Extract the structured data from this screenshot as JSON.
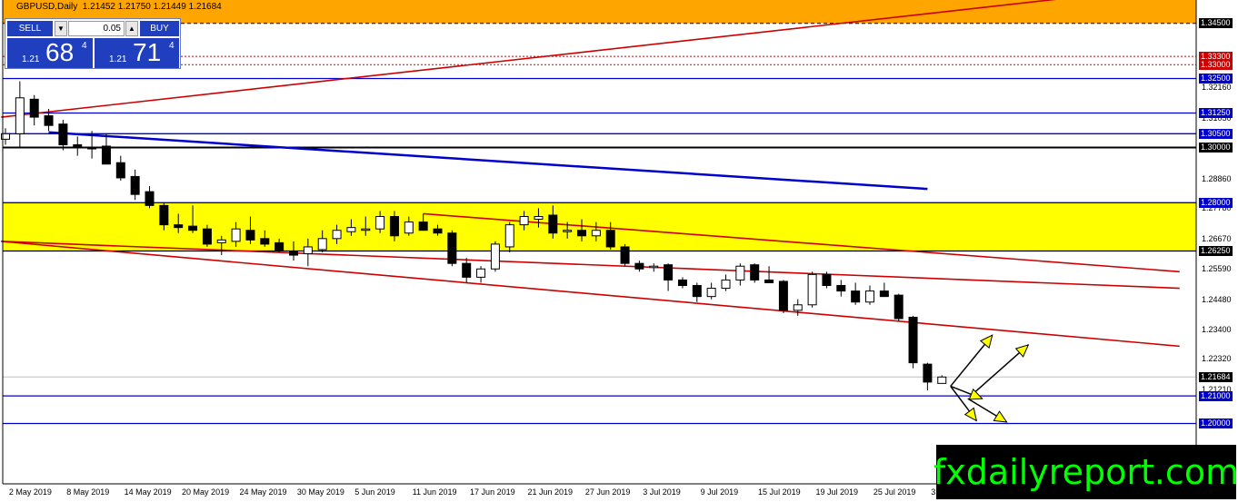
{
  "header": {
    "text": "GBPUSD,Daily  1.21452 1.21750 1.21449 1.21684"
  },
  "trade_panel": {
    "sell_label": "SELL",
    "buy_label": "BUY",
    "lot": "0.05",
    "sell_small": "1.21",
    "sell_big": "68",
    "sell_sup": "4",
    "buy_small": "1.21",
    "buy_big": "71",
    "buy_sup": "4"
  },
  "watermark": "fxdailyreport.com",
  "colors": {
    "zone": "#ffff00",
    "top_band": "#ffa500",
    "blue_line": "#0000cc",
    "red_line": "#cc0000",
    "arrow": "#ffff00"
  },
  "chart_data": {
    "type": "candlestick",
    "symbol": "GBPUSD",
    "timeframe": "Daily",
    "ylim": [
      1.195,
      1.355
    ],
    "price_labels": [
      "1.32160",
      "1.31050",
      "1.28860",
      "1.27780",
      "1.26670",
      "1.25590",
      "1.24480",
      "1.23400",
      "1.22320",
      "1.21210"
    ],
    "price_tags": [
      {
        "label": "1.34500",
        "value": 1.345,
        "style": "black"
      },
      {
        "label": "1.33300",
        "value": 1.333,
        "style": "red"
      },
      {
        "label": "1.33000",
        "value": 1.33,
        "style": "red"
      },
      {
        "label": "1.32500",
        "value": 1.325,
        "style": "blue"
      },
      {
        "label": "1.31250",
        "value": 1.3125,
        "style": "blue"
      },
      {
        "label": "1.30500",
        "value": 1.305,
        "style": "blue"
      },
      {
        "label": "1.30000",
        "value": 1.3,
        "style": "black"
      },
      {
        "label": "1.28000",
        "value": 1.28,
        "style": "blue"
      },
      {
        "label": "1.26250",
        "value": 1.2625,
        "style": "black"
      },
      {
        "label": "1.21684",
        "value": 1.21684,
        "style": "black"
      },
      {
        "label": "1.21000",
        "value": 1.21,
        "style": "blue"
      },
      {
        "label": "1.20000",
        "value": 1.2,
        "style": "blue"
      }
    ],
    "date_labels": [
      {
        "text": "2 May 2019",
        "index": 1
      },
      {
        "text": "8 May 2019",
        "index": 5
      },
      {
        "text": "14 May 2019",
        "index": 9
      },
      {
        "text": "20 May 2019",
        "index": 13
      },
      {
        "text": "24 May 2019",
        "index": 17
      },
      {
        "text": "30 May 2019",
        "index": 21
      },
      {
        "text": "5 Jun 2019",
        "index": 25
      },
      {
        "text": "11 Jun 2019",
        "index": 29
      },
      {
        "text": "17 Jun 2019",
        "index": 33
      },
      {
        "text": "21 Jun 2019",
        "index": 37
      },
      {
        "text": "27 Jun 2019",
        "index": 41
      },
      {
        "text": "3 Jul 2019",
        "index": 45
      },
      {
        "text": "9 Jul 2019",
        "index": 49
      },
      {
        "text": "15 Jul 2019",
        "index": 53
      },
      {
        "text": "19 Jul 2019",
        "index": 57
      },
      {
        "text": "25 Jul 2019",
        "index": 61
      },
      {
        "text": "3",
        "index": 65
      }
    ],
    "candles": [
      {
        "o": 1.303,
        "h": 1.307,
        "l": 1.301,
        "c": 1.305
      },
      {
        "o": 1.305,
        "h": 1.324,
        "l": 1.3,
        "c": 1.318
      },
      {
        "o": 1.3175,
        "h": 1.319,
        "l": 1.308,
        "c": 1.311
      },
      {
        "o": 1.3115,
        "h": 1.314,
        "l": 1.306,
        "c": 1.308
      },
      {
        "o": 1.3085,
        "h": 1.31,
        "l": 1.299,
        "c": 1.301
      },
      {
        "o": 1.301,
        "h": 1.304,
        "l": 1.297,
        "c": 1.3005
      },
      {
        "o": 1.3,
        "h": 1.306,
        "l": 1.296,
        "c": 1.2995
      },
      {
        "o": 1.3005,
        "h": 1.305,
        "l": 1.294,
        "c": 1.294
      },
      {
        "o": 1.2945,
        "h": 1.297,
        "l": 1.288,
        "c": 1.289
      },
      {
        "o": 1.2895,
        "h": 1.292,
        "l": 1.281,
        "c": 1.283
      },
      {
        "o": 1.284,
        "h": 1.286,
        "l": 1.278,
        "c": 1.279
      },
      {
        "o": 1.279,
        "h": 1.28,
        "l": 1.27,
        "c": 1.272
      },
      {
        "o": 1.272,
        "h": 1.276,
        "l": 1.269,
        "c": 1.271
      },
      {
        "o": 1.2715,
        "h": 1.279,
        "l": 1.269,
        "c": 1.27
      },
      {
        "o": 1.2705,
        "h": 1.272,
        "l": 1.264,
        "c": 1.265
      },
      {
        "o": 1.2655,
        "h": 1.268,
        "l": 1.261,
        "c": 1.2665
      },
      {
        "o": 1.266,
        "h": 1.273,
        "l": 1.264,
        "c": 1.2705
      },
      {
        "o": 1.27,
        "h": 1.275,
        "l": 1.265,
        "c": 1.2665
      },
      {
        "o": 1.267,
        "h": 1.27,
        "l": 1.264,
        "c": 1.265
      },
      {
        "o": 1.2655,
        "h": 1.267,
        "l": 1.262,
        "c": 1.2625
      },
      {
        "o": 1.2625,
        "h": 1.266,
        "l": 1.259,
        "c": 1.261
      },
      {
        "o": 1.2615,
        "h": 1.267,
        "l": 1.257,
        "c": 1.264
      },
      {
        "o": 1.263,
        "h": 1.27,
        "l": 1.262,
        "c": 1.267
      },
      {
        "o": 1.267,
        "h": 1.272,
        "l": 1.265,
        "c": 1.27
      },
      {
        "o": 1.2695,
        "h": 1.274,
        "l": 1.268,
        "c": 1.271
      },
      {
        "o": 1.27,
        "h": 1.275,
        "l": 1.268,
        "c": 1.2705
      },
      {
        "o": 1.2705,
        "h": 1.277,
        "l": 1.269,
        "c": 1.275
      },
      {
        "o": 1.275,
        "h": 1.277,
        "l": 1.266,
        "c": 1.268
      },
      {
        "o": 1.269,
        "h": 1.275,
        "l": 1.268,
        "c": 1.273
      },
      {
        "o": 1.273,
        "h": 1.276,
        "l": 1.27,
        "c": 1.27
      },
      {
        "o": 1.2705,
        "h": 1.272,
        "l": 1.268,
        "c": 1.269
      },
      {
        "o": 1.269,
        "h": 1.27,
        "l": 1.257,
        "c": 1.258
      },
      {
        "o": 1.258,
        "h": 1.26,
        "l": 1.251,
        "c": 1.253
      },
      {
        "o": 1.253,
        "h": 1.257,
        "l": 1.251,
        "c": 1.256
      },
      {
        "o": 1.256,
        "h": 1.266,
        "l": 1.255,
        "c": 1.265
      },
      {
        "o": 1.264,
        "h": 1.273,
        "l": 1.262,
        "c": 1.272
      },
      {
        "o": 1.272,
        "h": 1.277,
        "l": 1.27,
        "c": 1.275
      },
      {
        "o": 1.274,
        "h": 1.278,
        "l": 1.271,
        "c": 1.275
      },
      {
        "o": 1.2755,
        "h": 1.279,
        "l": 1.267,
        "c": 1.269
      },
      {
        "o": 1.2695,
        "h": 1.273,
        "l": 1.267,
        "c": 1.27
      },
      {
        "o": 1.27,
        "h": 1.274,
        "l": 1.266,
        "c": 1.268
      },
      {
        "o": 1.268,
        "h": 1.273,
        "l": 1.266,
        "c": 1.27
      },
      {
        "o": 1.27,
        "h": 1.273,
        "l": 1.263,
        "c": 1.264
      },
      {
        "o": 1.264,
        "h": 1.265,
        "l": 1.257,
        "c": 1.258
      },
      {
        "o": 1.258,
        "h": 1.259,
        "l": 1.255,
        "c": 1.256
      },
      {
        "o": 1.2565,
        "h": 1.258,
        "l": 1.255,
        "c": 1.257
      },
      {
        "o": 1.2575,
        "h": 1.258,
        "l": 1.248,
        "c": 1.252
      },
      {
        "o": 1.252,
        "h": 1.253,
        "l": 1.249,
        "c": 1.25
      },
      {
        "o": 1.25,
        "h": 1.251,
        "l": 1.244,
        "c": 1.246
      },
      {
        "o": 1.246,
        "h": 1.251,
        "l": 1.245,
        "c": 1.249
      },
      {
        "o": 1.249,
        "h": 1.254,
        "l": 1.248,
        "c": 1.252
      },
      {
        "o": 1.252,
        "h": 1.258,
        "l": 1.25,
        "c": 1.257
      },
      {
        "o": 1.2575,
        "h": 1.258,
        "l": 1.251,
        "c": 1.252
      },
      {
        "o": 1.252,
        "h": 1.257,
        "l": 1.251,
        "c": 1.251
      },
      {
        "o": 1.2515,
        "h": 1.252,
        "l": 1.24,
        "c": 1.241
      },
      {
        "o": 1.241,
        "h": 1.245,
        "l": 1.239,
        "c": 1.243
      },
      {
        "o": 1.243,
        "h": 1.255,
        "l": 1.242,
        "c": 1.254
      },
      {
        "o": 1.254,
        "h": 1.255,
        "l": 1.249,
        "c": 1.25
      },
      {
        "o": 1.25,
        "h": 1.252,
        "l": 1.246,
        "c": 1.248
      },
      {
        "o": 1.248,
        "h": 1.251,
        "l": 1.243,
        "c": 1.244
      },
      {
        "o": 1.244,
        "h": 1.25,
        "l": 1.243,
        "c": 1.248
      },
      {
        "o": 1.248,
        "h": 1.251,
        "l": 1.246,
        "c": 1.246
      },
      {
        "o": 1.2465,
        "h": 1.247,
        "l": 1.237,
        "c": 1.238
      },
      {
        "o": 1.2385,
        "h": 1.239,
        "l": 1.22,
        "c": 1.222
      },
      {
        "o": 1.2215,
        "h": 1.222,
        "l": 1.212,
        "c": 1.215
      },
      {
        "o": 1.21452,
        "h": 1.2175,
        "l": 1.21449,
        "c": 1.21684
      }
    ],
    "horizontal_lines": [
      {
        "value": 1.345,
        "style": "black-dashed"
      },
      {
        "value": 1.333,
        "style": "red-dotted"
      },
      {
        "value": 1.33,
        "style": "red-dotted"
      },
      {
        "value": 1.325,
        "style": "blue"
      },
      {
        "value": 1.3125,
        "style": "blue"
      },
      {
        "value": 1.305,
        "style": "blue"
      },
      {
        "value": 1.3,
        "style": "black-thick"
      },
      {
        "value": 1.28,
        "style": "blue"
      },
      {
        "value": 1.2625,
        "style": "black"
      },
      {
        "value": 1.21684,
        "style": "gray-thin"
      },
      {
        "value": 1.21,
        "style": "blue"
      },
      {
        "value": 1.2,
        "style": "blue"
      }
    ],
    "zone": {
      "from": 1.2625,
      "to": 1.28
    },
    "top_band": {
      "from": 1.345,
      "to": 1.355
    },
    "trendlines": [
      {
        "from": {
          "i": -0.3,
          "v": 1.311
        },
        "to": {
          "i": 76,
          "v": 1.3555
        },
        "color": "red"
      },
      {
        "from": {
          "i": -0.3,
          "v": 1.266
        },
        "to": {
          "i": 81.5,
          "v": 1.249
        },
        "color": "red"
      },
      {
        "from": {
          "i": 29,
          "v": 1.276
        },
        "to": {
          "i": 81.5,
          "v": 1.255
        },
        "color": "red"
      },
      {
        "from": {
          "i": -0.3,
          "v": 1.266
        },
        "to": {
          "i": 81.5,
          "v": 1.228
        },
        "color": "red"
      },
      {
        "from": {
          "i": 3,
          "v": 1.3055
        },
        "to": {
          "i": 64,
          "v": 1.285
        },
        "color": "blue"
      }
    ],
    "scenario_arrows": [
      {
        "from": {
          "i": 65.6,
          "v": 1.2135
        },
        "to": {
          "i": 68.5,
          "v": 1.232
        }
      },
      {
        "from": {
          "i": 67,
          "v": 1.21
        },
        "to": {
          "i": 71,
          "v": 1.2285
        }
      },
      {
        "from": {
          "i": 65.6,
          "v": 1.2135
        },
        "to": {
          "i": 67.8,
          "v": 1.209
        }
      },
      {
        "from": {
          "i": 65.6,
          "v": 1.2135
        },
        "to": {
          "i": 67.4,
          "v": 1.201
        }
      },
      {
        "from": {
          "i": 66.8,
          "v": 1.209
        },
        "to": {
          "i": 69.5,
          "v": 1.2005
        }
      }
    ]
  }
}
